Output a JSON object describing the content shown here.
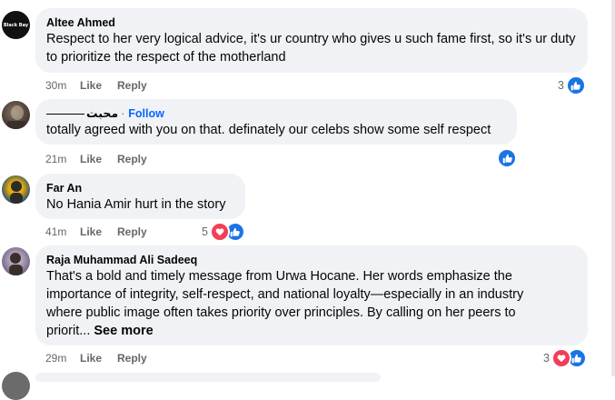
{
  "comments": [
    {
      "author": "Altee Ahmed",
      "avatar_text": "Black Bay",
      "text": "Respect to her very logical advice, it's ur country who gives u such fame first, so it's ur duty to prioritize the respect of the motherland",
      "time": "30m",
      "like_label": "Like",
      "reply_label": "Reply",
      "reaction_count": "3",
      "reactions": [
        "like-icon"
      ]
    },
    {
      "author": "محبت",
      "dot": "·",
      "follow_label": "Follow",
      "text": "totally agreed with you on that. definately our celebs show some self respect",
      "time": "21m",
      "like_label": "Like",
      "reply_label": "Reply",
      "reaction_count": "",
      "reactions": [
        "like-icon"
      ]
    },
    {
      "author": "Far An",
      "text": "No Hania Amir hurt in the story",
      "time": "41m",
      "like_label": "Like",
      "reply_label": "Reply",
      "reaction_count": "5",
      "reactions": [
        "love-icon",
        "like-icon"
      ]
    },
    {
      "author": "Raja Muhammad Ali Sadeeq",
      "text_lines": [
        "That's a bold and timely message from Urwa Hocane. Her words emphasize the",
        "importance of integrity, self-respect, and national loyalty—especially in an industry",
        "where public image often takes priority over principles. By calling on her peers to",
        "priorit..."
      ],
      "see_more": "See more",
      "time": "29m",
      "like_label": "Like",
      "reply_label": "Reply",
      "reaction_count": "3",
      "reactions": [
        "love-icon",
        "like-icon"
      ]
    }
  ],
  "colors": {
    "bubble": "#f0f2f5",
    "like_blue": "#1b74e4",
    "love_red": "#f33e58",
    "follow_blue": "#0866ff",
    "meta_gray": "#65676b"
  }
}
